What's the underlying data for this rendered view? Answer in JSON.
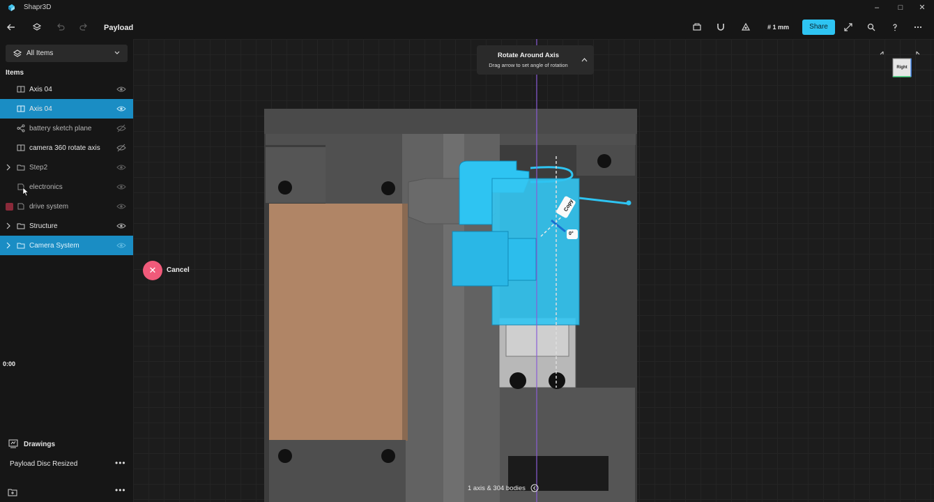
{
  "app": {
    "title": "Shapr3D"
  },
  "window_controls": {
    "minimize": "–",
    "maximize": "□",
    "close": "✕"
  },
  "toolbar": {
    "doc_title": "Payload",
    "units": "# 1 mm",
    "share_label": "Share"
  },
  "sidebar": {
    "filter_label": "All Items",
    "items_header": "Items",
    "items": [
      {
        "label": "Axis 04",
        "icon": "axis-icon",
        "selected": false,
        "visible": true
      },
      {
        "label": "Axis 04",
        "icon": "axis-icon",
        "selected": true,
        "visible": true
      },
      {
        "label": "battery sketch plane",
        "icon": "sketch-icon",
        "selected": false,
        "visible": false
      },
      {
        "label": "camera 360 rotate axis",
        "icon": "axis-icon",
        "selected": false,
        "visible": false
      },
      {
        "label": "Step2",
        "icon": "folder-icon",
        "selected": false,
        "visible": true
      },
      {
        "label": "electronics",
        "icon": "folder-icon",
        "selected": false,
        "visible": true
      },
      {
        "label": "drive system",
        "icon": "folder-icon",
        "selected": false,
        "visible": true
      },
      {
        "label": "Structure",
        "icon": "folder-icon",
        "selected": false,
        "visible": true
      },
      {
        "label": "Camera System",
        "icon": "folder-icon",
        "selected": true,
        "visible": true
      }
    ],
    "drawings_header": "Drawings",
    "drawing_item": "Payload Disc Resized",
    "timecode": "0:00"
  },
  "viewport": {
    "hint_title": "Rotate Around Axis",
    "hint_text": "Drag arrow to set angle of rotation",
    "cancel_label": "Cancel",
    "copy_label": "Copy",
    "angle_label": "0°",
    "status": "1 axis & 304 bodies",
    "view_cube_face": "Right",
    "accent_color": "#2ec4f2",
    "selection_color": "#1a8dc4"
  }
}
